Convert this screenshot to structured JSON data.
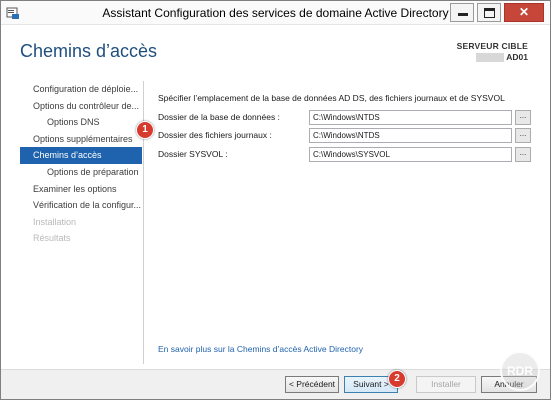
{
  "window": {
    "title": "Assistant Configuration des services de domaine Active Directory"
  },
  "header": {
    "page_title": "Chemins d’accès",
    "target_label": "SERVEUR CIBLE",
    "target_name": "AD01"
  },
  "nav": [
    {
      "label": "Configuration de déploie...",
      "level": 0,
      "state": "normal"
    },
    {
      "label": "Options du contrôleur de...",
      "level": 0,
      "state": "normal"
    },
    {
      "label": "Options DNS",
      "level": 1,
      "state": "normal"
    },
    {
      "label": "Options supplémentaires",
      "level": 0,
      "state": "normal"
    },
    {
      "label": "Chemins d’accès",
      "level": 0,
      "state": "active"
    },
    {
      "label": "Options de préparation",
      "level": 1,
      "state": "normal"
    },
    {
      "label": "Examiner les options",
      "level": 0,
      "state": "normal"
    },
    {
      "label": "Vérification de la configur...",
      "level": 0,
      "state": "normal"
    },
    {
      "label": "Installation",
      "level": 0,
      "state": "disabled"
    },
    {
      "label": "Résultats",
      "level": 0,
      "state": "disabled"
    }
  ],
  "main": {
    "description": "Spécifier l’emplacement de la base de données AD DS, des fichiers journaux et de SYSVOL",
    "fields": [
      {
        "label": "Dossier de la base de données :",
        "value": "C:\\Windows\\NTDS",
        "browse_label": "..."
      },
      {
        "label": "Dossier des fichiers journaux :",
        "value": "C:\\Windows\\NTDS",
        "browse_label": "..."
      },
      {
        "label": "Dossier SYSVOL :",
        "value": "C:\\Windows\\SYSVOL",
        "browse_label": "..."
      }
    ],
    "help_link": "En savoir plus sur la Chemins d’accès Active Directory"
  },
  "footer": {
    "previous": "< Précédent",
    "next": "Suivant >",
    "install": "Installer",
    "cancel": "Annuler"
  },
  "annotations": {
    "badge1": "1",
    "badge2": "2"
  },
  "watermark": {
    "text": "RDR"
  },
  "colors": {
    "accent": "#1f62ad",
    "page_title": "#1f4f7f",
    "badge": "#d83b2e",
    "close_button": "#c7463a"
  }
}
